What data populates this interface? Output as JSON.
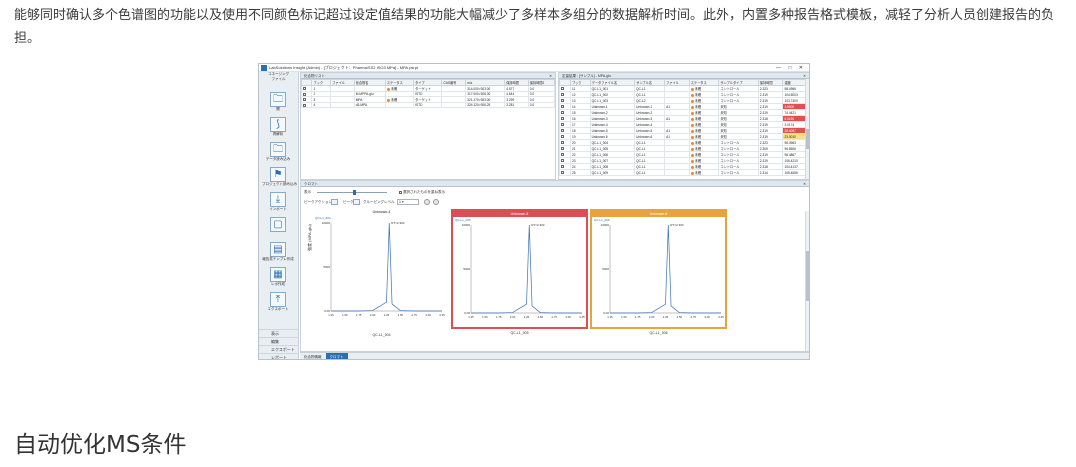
{
  "article": {
    "paragraph": "能够同时确认多个色谱图的功能以及使用不同颜色标记超过设定值结果的功能大幅减少了多样本多组分的数据解析时间。此外，内置多种报告格式模板，减轻了分析人员创建报告的负担。",
    "heading": "自动优化MS条件"
  },
  "app": {
    "title": "LabSolutions Insight (Admin) - [プロジェクト：Pharma\\SS2 ISO3 MPa] - MPA.psrpt",
    "window_controls": "— □ ✕",
    "ribbon": {
      "top_label": "コネージング",
      "file_label": "ファイル",
      "buttons": [
        {
          "icon": "folder-open-icon",
          "glyph": "🗀",
          "label": "開"
        },
        {
          "icon": "wand-icon",
          "glyph": "⟆",
          "label": "再解析"
        },
        {
          "icon": "folder-stack-icon",
          "glyph": "🗀",
          "label": "データ読み込み"
        },
        {
          "icon": "flask-data-icon",
          "glyph": "⚑",
          "label": "プロジェクト読み込み"
        },
        {
          "icon": "import-icon",
          "glyph": "⤓",
          "label": "インポート"
        },
        {
          "icon": "disabled-icon",
          "glyph": "▢",
          "label": ""
        },
        {
          "icon": "report-template-icon",
          "glyph": "▤",
          "label": "報告書テンプレ作成"
        },
        {
          "icon": "report-grid-icon",
          "glyph": "▦",
          "label": "レポ作成"
        },
        {
          "icon": "export-icon",
          "glyph": "⤒",
          "label": "エクスポート"
        }
      ],
      "bottom_items": [
        "表示",
        "編集",
        "エクスポート",
        "レポート"
      ]
    },
    "left_table": {
      "header": "化合物リスト",
      "columns": [
        "",
        "ブック",
        "ファイル",
        "化合物名",
        "ステータス",
        "タイプ",
        "CAS番号",
        "m/z",
        "保持時間",
        "保持時間2"
      ],
      "rows": [
        [
          "",
          "1",
          "",
          "",
          "未確",
          "ターゲット",
          "",
          "314.000>303.00",
          "4.577",
          "0.0"
        ],
        [
          "",
          "2",
          "",
          "M-MPPA-glu",
          "",
          "ISTD",
          "",
          "317.000>306.00",
          "4.644",
          "0.0"
        ],
        [
          "",
          "3",
          "",
          "MPA",
          "未確",
          "ターゲット",
          "",
          "321.170>303.00",
          "3.299",
          "0.0"
        ],
        [
          "",
          "4",
          "",
          "d3-MPA",
          "",
          "ISTD",
          "",
          "324.120>306.25",
          "3.281",
          "0.0"
        ]
      ]
    },
    "right_table": {
      "header": "定量結果 : [サンプル] - MPA-glu",
      "columns": [
        "",
        "ブック",
        "データファイル名",
        "サンプル名",
        "ファイル",
        "ステータス",
        "サンプルタイプ",
        "保持時間",
        "濃度"
      ],
      "rows": [
        [
          "",
          "11",
          "QC-L1_001",
          "QC-L1",
          "",
          "未確",
          "コントロール",
          "2.323",
          "98.4966"
        ],
        [
          "",
          "12",
          "QC-L1_002",
          "QC-L1",
          "",
          "未確",
          "コントロール",
          "2.319",
          "104.5003"
        ],
        [
          "",
          "13",
          "QC-L1_003",
          "QC-L2",
          "",
          "未確",
          "コントロール",
          "2.319",
          "103.7400"
        ],
        [
          "",
          "14",
          "Unknown-1",
          "Unknown-1",
          "A1",
          "未確",
          "未知",
          "2.319",
          "3.5900"
        ],
        [
          "",
          "15",
          "Unknown-2",
          "Unknown-2",
          "",
          "未確",
          "未知",
          "2.319",
          "74.4421"
        ],
        [
          "",
          "16",
          "Unknown-3",
          "Unknown-3",
          "A1",
          "未確",
          "未知",
          "2.318",
          "6.0150"
        ],
        [
          "",
          "17",
          "Unknown-4",
          "Unknown-4",
          "",
          "未確",
          "未知",
          "2.319",
          "3.0174"
        ],
        [
          "",
          "18",
          "Unknown-5",
          "Unknown-5",
          "A1",
          "未確",
          "未知",
          "2.319",
          "28.4097"
        ],
        [
          "",
          "19",
          "Unknown-6",
          "Unknown-6",
          "A1",
          "未確",
          "未知",
          "2.319",
          "23.0010"
        ],
        [
          "",
          "20",
          "QC-L1_004",
          "QC-L1",
          "",
          "未確",
          "コントロール",
          "2.323",
          "96.4963"
        ],
        [
          "",
          "21",
          "QC-L1_005",
          "QC-L1",
          "",
          "未確",
          "コントロール",
          "2.305",
          "96.8506"
        ],
        [
          "",
          "22",
          "QC-L1_006",
          "QC-L1",
          "",
          "未確",
          "コントロール",
          "2.319",
          "96.4867"
        ],
        [
          "",
          "23",
          "QC-L1_007",
          "QC-L1",
          "",
          "未確",
          "コントロール",
          "2.319",
          "106.4210"
        ],
        [
          "",
          "24",
          "QC-L1_008",
          "QC-L1",
          "",
          "未確",
          "コントロール",
          "2.318",
          "104.4137"
        ],
        [
          "",
          "25",
          "QC-L1_009",
          "QC-L1",
          "",
          "未確",
          "コントロール",
          "2.314",
          "105.4656"
        ]
      ],
      "highlights": {
        "14": "c-red",
        "16": "c-red",
        "18": "c-red",
        "19": "c-yel"
      }
    },
    "plot_pane": {
      "header": "クロマト",
      "zoom_label": "表示",
      "overlay_label": "選択されたものを重ね表示",
      "peak_label": "ピークアクション",
      "peak_name": "ピーク",
      "group_label": "グルーピングレベル",
      "group_value": "1",
      "y_axis_label": "強度 (MPA-glu)"
    },
    "bottom_tabs": [
      "化合物情報",
      "クロマト"
    ]
  },
  "chart_data": [
    {
      "type": "line",
      "title": "Unknown-4",
      "sample": "QC-L1_004",
      "peak_label": "RT=2.300",
      "frame": "none",
      "x": [
        1.25,
        1.5,
        1.75,
        2.0,
        2.25,
        2.3,
        2.35,
        2.5,
        2.75,
        3.0,
        3.25
      ],
      "y": [
        0,
        0,
        0,
        50,
        1000,
        10000,
        800,
        40,
        0,
        0,
        0
      ],
      "xticks": [
        "1.25",
        "1.50",
        "1.75",
        "2.00",
        "2.25",
        "2.50",
        "2.75",
        "3.00",
        "3.25"
      ],
      "yticks": [
        "10000",
        "5000",
        "0.00"
      ]
    },
    {
      "type": "line",
      "title": "Unknown-5",
      "sample": "QC-L1_005",
      "peak_label": "RT=2.300",
      "frame": "#d84f55",
      "x": [
        1.25,
        1.5,
        1.75,
        2.0,
        2.25,
        2.3,
        2.35,
        2.5,
        2.75,
        3.0,
        3.25
      ],
      "y": [
        0,
        0,
        0,
        50,
        1000,
        10000,
        800,
        40,
        0,
        0,
        0
      ],
      "xticks": [
        "1.25",
        "1.50",
        "1.75",
        "2.00",
        "2.25",
        "2.50",
        "2.75",
        "3.00",
        "3.25"
      ],
      "yticks": [
        "10000",
        "5000",
        "0.00"
      ]
    },
    {
      "type": "line",
      "title": "Unknown-6",
      "sample": "QC-L1_006",
      "peak_label": "RT=2.300",
      "frame": "#e8a43c",
      "x": [
        1.25,
        1.5,
        1.75,
        2.0,
        2.25,
        2.3,
        2.35,
        2.5,
        2.75,
        3.0,
        3.25
      ],
      "y": [
        0,
        0,
        0,
        50,
        1000,
        10000,
        800,
        40,
        0,
        0,
        0
      ],
      "xticks": [
        "1.25",
        "1.50",
        "1.75",
        "2.00",
        "2.25",
        "2.50",
        "2.75",
        "3.00",
        "3.25"
      ],
      "yticks": [
        "10000",
        "5000",
        "0.00"
      ]
    }
  ]
}
